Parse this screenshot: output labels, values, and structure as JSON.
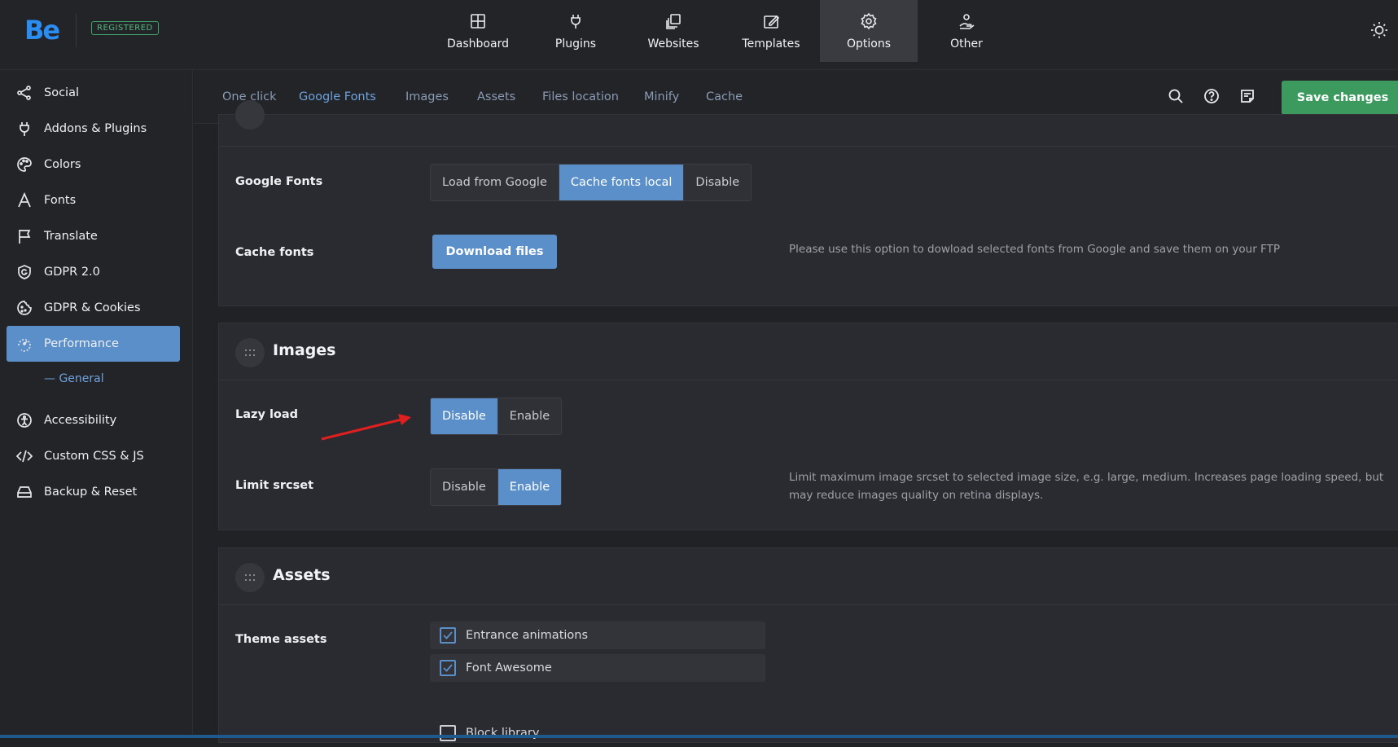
{
  "header": {
    "logo": "Be",
    "badge": "REGISTERED",
    "nav": [
      {
        "label": "Dashboard",
        "icon": "dashboard-icon"
      },
      {
        "label": "Plugins",
        "icon": "plug-icon"
      },
      {
        "label": "Websites",
        "icon": "websites-icon"
      },
      {
        "label": "Templates",
        "icon": "templates-icon"
      },
      {
        "label": "Options",
        "icon": "gear-icon",
        "active": true
      },
      {
        "label": "Other",
        "icon": "hand-icon"
      }
    ]
  },
  "sidebar": {
    "items": [
      {
        "label": "Social",
        "icon": "share-icon"
      },
      {
        "label": "Addons & Plugins",
        "icon": "plug-icon"
      },
      {
        "label": "Colors",
        "icon": "palette-icon"
      },
      {
        "label": "Fonts",
        "icon": "font-icon"
      },
      {
        "label": "Translate",
        "icon": "flag-icon"
      },
      {
        "label": "GDPR 2.0",
        "icon": "shield-icon"
      },
      {
        "label": "GDPR & Cookies",
        "icon": "cookie-icon"
      },
      {
        "label": "Performance",
        "icon": "speedometer-icon",
        "active": true
      },
      {
        "label": "Accessibility",
        "icon": "accessibility-icon"
      },
      {
        "label": "Custom CSS & JS",
        "icon": "code-icon"
      },
      {
        "label": "Backup & Reset",
        "icon": "backup-icon"
      }
    ],
    "sub_item": "— General"
  },
  "subnav": {
    "tabs": [
      "One click",
      "Google Fonts",
      "Images",
      "Assets",
      "Files location",
      "Minify",
      "Cache"
    ],
    "active_tab": "Google Fonts",
    "save_label": "Save changes"
  },
  "google_fonts": {
    "label": "Google Fonts",
    "options": [
      "Load from Google",
      "Cache fonts local",
      "Disable"
    ],
    "selected": "Cache fonts local",
    "cache_label": "Cache fonts",
    "download_label": "Download files",
    "cache_help": "Please use this option to dowload selected fonts from Google and save them on your FTP"
  },
  "images": {
    "title": "Images",
    "lazy_label": "Lazy load",
    "lazy_options": [
      "Disable",
      "Enable"
    ],
    "lazy_selected": "Disable",
    "srcset_label": "Limit srcset",
    "srcset_options": [
      "Disable",
      "Enable"
    ],
    "srcset_selected": "Enable",
    "srcset_help": "Limit maximum image srcset to selected image size, e.g. large, medium. Increases page loading speed, but may reduce images quality on retina displays."
  },
  "assets": {
    "title": "Assets",
    "theme_label": "Theme assets",
    "checks": [
      {
        "label": "Entrance animations",
        "checked": true
      },
      {
        "label": "Font Awesome",
        "checked": true
      },
      {
        "label": "Block library",
        "checked": false
      }
    ]
  },
  "colors": {
    "accent": "#5b8fc9",
    "save": "#3c9a5f",
    "annotation_arrow": "#e01f1f"
  }
}
